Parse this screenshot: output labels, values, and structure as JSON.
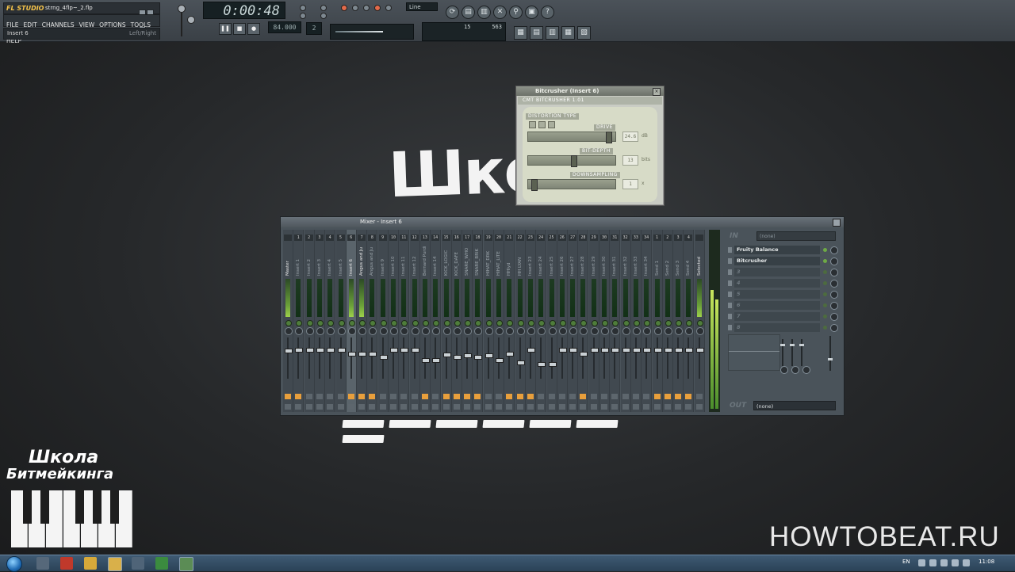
{
  "fl": {
    "logo": "FL STUDIO",
    "file_name": "strng_4flp~_2.flp",
    "menu": [
      "FILE",
      "EDIT",
      "CHANNELS",
      "VIEW",
      "OPTIONS",
      "TOOLS",
      "HELP"
    ],
    "hint_left": "Insert 6",
    "hint_right": "Left/Right",
    "time": "0:00:48",
    "tempo": "84.000",
    "pattern": "2",
    "line_mode": "Line",
    "cpu": "563",
    "poly": "15"
  },
  "bitcrusher": {
    "title": "Bitcrusher (Insert 6)",
    "header": "CMT BITCRUSHER 1.01",
    "distortion_label": "DISTORTION TYPE",
    "drive_label": "DRIVE",
    "drive_value": "24.6",
    "drive_unit": "dB",
    "bitdepth_label": "BIT-DEPTH",
    "bitdepth_value": "13",
    "bitdepth_unit": "bits",
    "downsampling_label": "DOWNSAMPLING",
    "downsampling_value": "1",
    "downsampling_unit": "x",
    "drive_level": 0.94,
    "bitdepth_level": 0.52,
    "downsampling_level": 0.04
  },
  "mixer": {
    "title": "Mixer - Insert 6",
    "strips": [
      {
        "num": "",
        "name": "Master",
        "sel": false,
        "hot": true,
        "fader": 0.7,
        "fx": true
      },
      {
        "num": "1",
        "name": "Insert 1",
        "sel": false,
        "hot": false,
        "fader": 0.72,
        "fx": true
      },
      {
        "num": "2",
        "name": "Insert 2",
        "sel": false,
        "hot": false,
        "fader": 0.72,
        "fx": false
      },
      {
        "num": "3",
        "name": "Insert 3",
        "sel": false,
        "hot": false,
        "fader": 0.72,
        "fx": false
      },
      {
        "num": "4",
        "name": "Insert 4",
        "sel": false,
        "hot": false,
        "fader": 0.72,
        "fx": false
      },
      {
        "num": "5",
        "name": "Insert 5",
        "sel": false,
        "hot": false,
        "fader": 0.72,
        "fx": false
      },
      {
        "num": "6",
        "name": "Insert 6",
        "sel": true,
        "hot": true,
        "fader": 0.62,
        "fx": true
      },
      {
        "num": "7",
        "name": "Angus and Ju",
        "sel": false,
        "hot": true,
        "fader": 0.62,
        "fx": true
      },
      {
        "num": "8",
        "name": "Angus and Ju",
        "sel": false,
        "hot": false,
        "fader": 0.62,
        "fx": true
      },
      {
        "num": "9",
        "name": "Insert 9",
        "sel": false,
        "hot": false,
        "fader": 0.55,
        "fx": false
      },
      {
        "num": "10",
        "name": "Insert 10",
        "sel": false,
        "hot": false,
        "fader": 0.72,
        "fx": false
      },
      {
        "num": "11",
        "name": "Insert 11",
        "sel": false,
        "hot": false,
        "fader": 0.72,
        "fx": false
      },
      {
        "num": "12",
        "name": "Insert 12",
        "sel": false,
        "hot": false,
        "fader": 0.72,
        "fx": false
      },
      {
        "num": "13",
        "name": "Bernard Purdi",
        "sel": false,
        "hot": false,
        "fader": 0.45,
        "fx": true
      },
      {
        "num": "14",
        "name": "Insert 14",
        "sel": false,
        "hot": false,
        "fader": 0.45,
        "fx": false
      },
      {
        "num": "15",
        "name": "KICK_LOGIC",
        "sel": false,
        "hot": false,
        "fader": 0.6,
        "fx": true
      },
      {
        "num": "16",
        "name": "KICK_DAFE",
        "sel": false,
        "hot": false,
        "fader": 0.55,
        "fx": true
      },
      {
        "num": "17",
        "name": "SNARE_WHO",
        "sel": false,
        "hot": false,
        "fader": 0.58,
        "fx": true
      },
      {
        "num": "18",
        "name": "SNARE_BRIK",
        "sel": false,
        "hot": false,
        "fader": 0.55,
        "fx": true
      },
      {
        "num": "19",
        "name": "HIHAT_DRK",
        "sel": false,
        "hot": false,
        "fader": 0.58,
        "fx": false
      },
      {
        "num": "20",
        "name": "HIHAT_LITE",
        "sel": false,
        "hot": false,
        "fader": 0.45,
        "fx": false
      },
      {
        "num": "21",
        "name": "HHlyd",
        "sel": false,
        "hot": false,
        "fader": 0.62,
        "fx": true
      },
      {
        "num": "22",
        "name": "HH LYAN",
        "sel": false,
        "hot": false,
        "fader": 0.4,
        "fx": true
      },
      {
        "num": "23",
        "name": "Insert 23",
        "sel": false,
        "hot": false,
        "fader": 0.72,
        "fx": true
      },
      {
        "num": "24",
        "name": "Insert 24",
        "sel": false,
        "hot": false,
        "fader": 0.35,
        "fx": false
      },
      {
        "num": "25",
        "name": "Insert 25",
        "sel": false,
        "hot": false,
        "fader": 0.35,
        "fx": false
      },
      {
        "num": "26",
        "name": "Insert 26",
        "sel": false,
        "hot": false,
        "fader": 0.72,
        "fx": false
      },
      {
        "num": "27",
        "name": "Insert 27",
        "sel": false,
        "hot": false,
        "fader": 0.72,
        "fx": false
      },
      {
        "num": "28",
        "name": "Insert 28",
        "sel": false,
        "hot": false,
        "fader": 0.62,
        "fx": true
      },
      {
        "num": "29",
        "name": "Insert 29",
        "sel": false,
        "hot": false,
        "fader": 0.72,
        "fx": false
      },
      {
        "num": "30",
        "name": "Insert 30",
        "sel": false,
        "hot": false,
        "fader": 0.72,
        "fx": false
      },
      {
        "num": "31",
        "name": "Insert 31",
        "sel": false,
        "hot": false,
        "fader": 0.72,
        "fx": false
      },
      {
        "num": "32",
        "name": "Insert 32",
        "sel": false,
        "hot": false,
        "fader": 0.72,
        "fx": false
      },
      {
        "num": "33",
        "name": "Insert 33",
        "sel": false,
        "hot": false,
        "fader": 0.72,
        "fx": false
      },
      {
        "num": "34",
        "name": "Insert 34",
        "sel": false,
        "hot": false,
        "fader": 0.72,
        "fx": false
      },
      {
        "num": "1",
        "name": "Send 1",
        "sel": false,
        "hot": false,
        "fader": 0.72,
        "fx": true
      },
      {
        "num": "2",
        "name": "Send 2",
        "sel": false,
        "hot": false,
        "fader": 0.72,
        "fx": true
      },
      {
        "num": "3",
        "name": "Send 3",
        "sel": false,
        "hot": false,
        "fader": 0.72,
        "fx": true
      },
      {
        "num": "4",
        "name": "Send 4",
        "sel": false,
        "hot": false,
        "fader": 0.72,
        "fx": true
      },
      {
        "num": "",
        "name": "Selected",
        "sel": false,
        "hot": true,
        "fader": 0.72,
        "fx": false
      }
    ],
    "in_label": "IN",
    "in_value": "(none)",
    "slots": [
      {
        "name": "Fruity Balance",
        "empty": false
      },
      {
        "name": "Bitcrusher",
        "empty": false
      },
      {
        "name": "3",
        "empty": true
      },
      {
        "name": "4",
        "empty": true
      },
      {
        "name": "5",
        "empty": true
      },
      {
        "name": "6",
        "empty": true
      },
      {
        "name": "7",
        "empty": true
      },
      {
        "name": "8",
        "empty": true
      }
    ],
    "out_label": "OUT",
    "out_value": "(none)"
  },
  "overlay": {
    "school_big": "Школа",
    "logo_line1": "Школа",
    "logo_line2": "Битмейкинга",
    "site": "HOWTOBEAT.RU"
  },
  "taskbar": {
    "lang": "EN",
    "time": "11:08"
  }
}
